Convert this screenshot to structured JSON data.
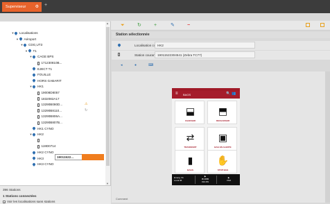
{
  "window": {
    "tab_label": "Superviseur",
    "tab_close": "⚙",
    "tab_add": "+"
  },
  "tree": {
    "nodes": [
      {
        "label": "Localisations",
        "arrow": "▼",
        "icon": "pin",
        "level": 0
      },
      {
        "label": "Aéroport",
        "arrow": "▼",
        "icon": "pin",
        "level": 1
      },
      {
        "label": "CDG,UT3",
        "arrow": "▼",
        "icon": "pin",
        "level": 2
      },
      {
        "label": "T1",
        "arrow": "▼",
        "icon": "pin",
        "level": 3
      },
      {
        "label": "CAGE BPS",
        "arrow": "▼",
        "icon": "pin",
        "level": 4
      },
      {
        "label": "171230810B...",
        "arrow": "",
        "icon": "phone",
        "level": 5
      },
      {
        "label": "EJECT T1",
        "arrow": "",
        "icon": "pin",
        "level": 4
      },
      {
        "label": "FOUILLE",
        "arrow": "",
        "icon": "pin",
        "level": 4
      },
      {
        "label": "HORS GABARIT",
        "arrow": "",
        "icon": "pin",
        "level": 4
      },
      {
        "label": "HK1",
        "arrow": "▼",
        "icon": "pin",
        "level": 4
      },
      {
        "label": "19008D8057",
        "arrow": "",
        "icon": "phone",
        "level": 5
      },
      {
        "label": "1832082A17",
        "arrow": "",
        "icon": "phone",
        "level": 5
      },
      {
        "label": "13290B080D...",
        "arrow": "",
        "icon": "phone",
        "level": 5
      },
      {
        "label": "13290B8110...",
        "arrow": "",
        "icon": "phone",
        "level": 5
      },
      {
        "label": "13290B806A...",
        "arrow": "",
        "icon": "phone",
        "level": 5
      },
      {
        "label": "13290B807B...",
        "arrow": "",
        "icon": "phone",
        "level": 5
      },
      {
        "label": "HK1 CYNO",
        "arrow": "",
        "icon": "pin",
        "level": 4
      },
      {
        "label": "HK2",
        "arrow": "▼",
        "icon": "pin",
        "level": 4
      },
      {
        "label": "19011522...",
        "arrow": "",
        "icon": "phone",
        "level": 5
      },
      {
        "label": "119D0714",
        "arrow": "",
        "icon": "phone",
        "level": 5
      },
      {
        "label": "HK2 CYNO",
        "arrow": "",
        "icon": "pin",
        "level": 4
      },
      {
        "label": "HK3",
        "arrow": "",
        "icon": "pin",
        "level": 4
      },
      {
        "label": "HK3 CYNO",
        "arrow": "",
        "icon": "pin",
        "level": 4
      }
    ],
    "warn_glyph": "⚠",
    "sync_glyph": "↻"
  },
  "footer": {
    "count": "396 Stations",
    "connected": "1 Stations connectées",
    "checkbox_label": "Voir les localisations sans stations",
    "checkbox_mark": "✓"
  },
  "toolbar": {
    "filter": "⏷",
    "refresh": "↻",
    "add": "+",
    "edit": "✎",
    "remove": "−"
  },
  "station": {
    "header": "Station sélectionnée",
    "loc_label": "Localisation courante",
    "loc_value": "HK2",
    "station_label": "Station courante",
    "station_value": "19011522304541 (Zebra TC77)"
  },
  "mini_tools": {
    "back": "◂",
    "view": "●",
    "keyboard": "⌨"
  },
  "phone": {
    "menu": "≡",
    "title": "BAGS",
    "search": "🔍",
    "users": "👥",
    "tiles": [
      {
        "label": "CHARGER",
        "glyph": "⬓"
      },
      {
        "label": "DECHARGER",
        "glyph": "⬒"
      },
      {
        "label": "TRANSFERT",
        "glyph": "⇄"
      },
      {
        "label": "BAG EN ALERTE",
        "glyph": "▣"
      },
      {
        "label": "BAGS",
        "glyph": "▮"
      },
      {
        "label": "STOP BAG",
        "glyph": "✋"
      }
    ],
    "bottom": {
      "left_line1": "Emerg.  61",
      "left_line2": "Local   96",
      "mid_line1": "▶",
      "mid_line2": "IB 2885",
      "mid_line3": "01/LNS",
      "right_line1": "▶",
      "right_line2": "VSO"
    }
  },
  "content": {
    "comment_label": "Comment"
  }
}
